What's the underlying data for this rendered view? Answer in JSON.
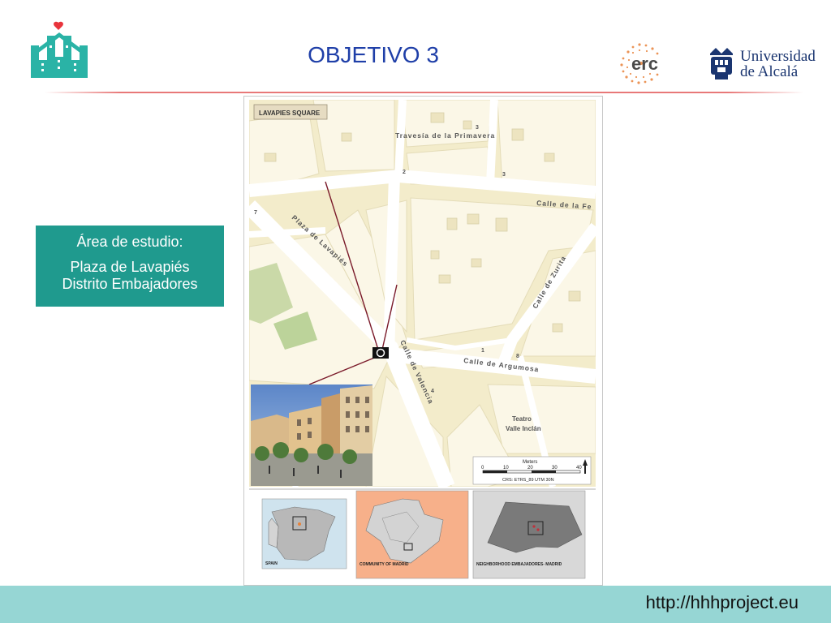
{
  "header": {
    "title": "OBJETIVO 3",
    "erc_logo_text": "erc",
    "university_line1": "Universidad",
    "university_line2": "de Alcalá"
  },
  "study_area": {
    "heading": "Área de estudio:",
    "line1": "Plaza de Lavapiés",
    "line2": "Distrito Embajadores"
  },
  "map": {
    "badge": "LAVAPIES SQUARE",
    "streets": [
      "Travesía de la Primavera",
      "Calle de la Fe",
      "Plaza de Lavapiés",
      "Calle de Zurita",
      "Calle de Argumosa",
      "Calle de Valencia"
    ],
    "building_numbers": [
      "3",
      "2",
      "7",
      "8",
      "1",
      "4",
      "3"
    ],
    "theatre": [
      "Teatro",
      "Valle Inclán"
    ],
    "scale": {
      "unit_label": "Meters",
      "ticks": [
        "0",
        "10",
        "20",
        "30",
        "40"
      ],
      "crs": "CRS: ETRS_89 UTM 30N"
    },
    "insets": [
      {
        "label": "SPAIN"
      },
      {
        "label": "COMMUNITY OF MADRID"
      },
      {
        "label": "NEIGHBORHOOD EMBAJADORES- MADRID"
      }
    ]
  },
  "footer": {
    "url": "http://hhhproject.eu"
  },
  "colors": {
    "title": "#1f3fa8",
    "study_box": "#1f9a8e",
    "footer": "#96d6d4",
    "map_ground": "#f3eccb",
    "map_block": "#fbf7e7",
    "street": "#ffffff",
    "sightline": "#7a1a2a"
  }
}
